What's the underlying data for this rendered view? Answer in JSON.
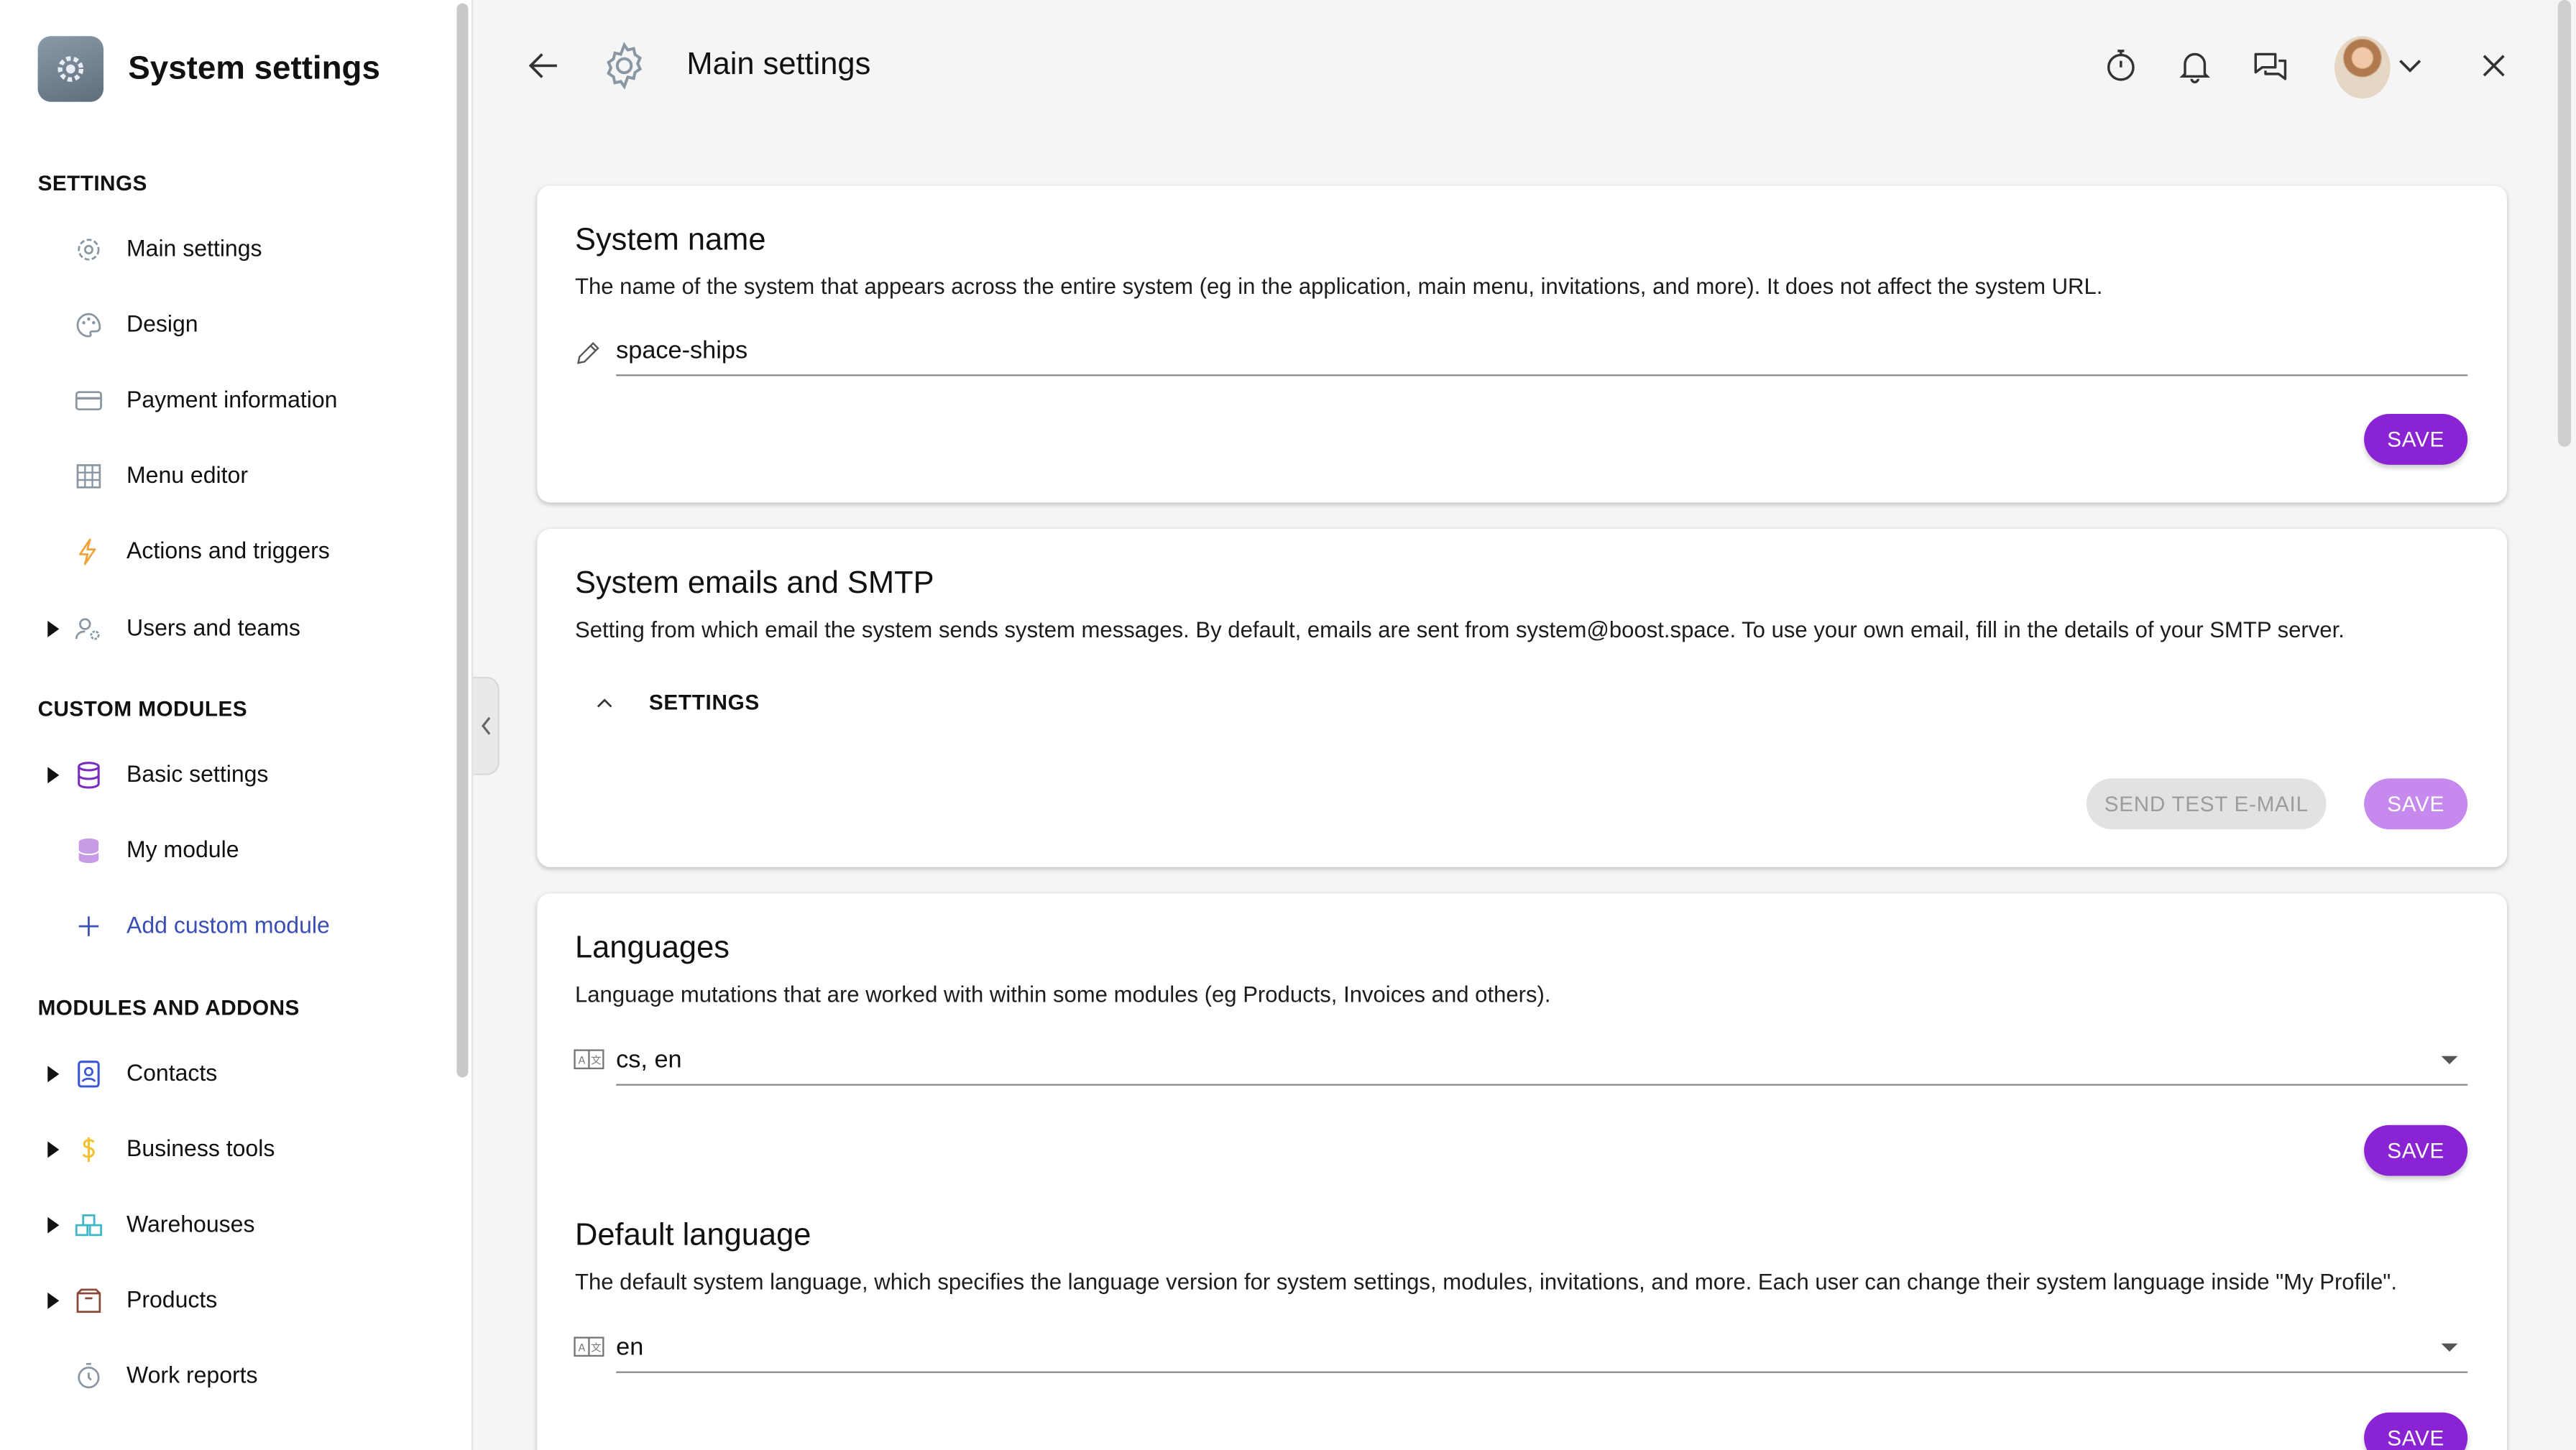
{
  "sidebar": {
    "app_title": "System settings",
    "sections": {
      "settings": "SETTINGS",
      "custom_modules": "CUSTOM MODULES",
      "modules_addons": "MODULES AND ADDONS"
    },
    "settings_items": [
      {
        "label": "Main settings",
        "icon": "gear-icon"
      },
      {
        "label": "Design",
        "icon": "palette-icon"
      },
      {
        "label": "Payment information",
        "icon": "card-icon"
      },
      {
        "label": "Menu editor",
        "icon": "grid-icon"
      },
      {
        "label": "Actions and triggers",
        "icon": "bolt-icon"
      },
      {
        "label": "Users and teams",
        "icon": "users-gear-icon"
      }
    ],
    "custom_items": [
      {
        "label": "Basic settings",
        "icon": "database-icon"
      },
      {
        "label": "My module",
        "icon": "database-icon"
      },
      {
        "label": "Add custom module",
        "icon": "plus-icon"
      }
    ],
    "addon_items": [
      {
        "label": "Contacts",
        "icon": "contact-book-icon"
      },
      {
        "label": "Business tools",
        "icon": "dollar-icon"
      },
      {
        "label": "Warehouses",
        "icon": "warehouse-icon"
      },
      {
        "label": "Products",
        "icon": "box-icon"
      },
      {
        "label": "Work reports",
        "icon": "stopwatch-icon"
      }
    ]
  },
  "header": {
    "title": "Main settings"
  },
  "cards": {
    "system_name": {
      "title": "System name",
      "description": "The name of the system that appears across the entire system (eg in the application, main menu, invitations, and more). It does not affect the system URL.",
      "value": "space-ships",
      "save_label": "SAVE"
    },
    "smtp": {
      "title": "System emails and SMTP",
      "description": "Setting from which email the system sends system messages. By default, emails are sent from system@boost.space. To use your own email, fill in the details of your SMTP server.",
      "accordion_label": "SETTINGS",
      "test_label": "SEND TEST E-MAIL",
      "save_label": "SAVE"
    },
    "languages": {
      "title": "Languages",
      "description": "Language mutations that are worked with within some modules (eg Products, Invoices and others).",
      "value": "cs, en",
      "save_label": "SAVE"
    },
    "default_language": {
      "title": "Default language",
      "description": "The default system language, which specifies the language version for system settings, modules, invitations, and more. Each user can change their system language inside \"My Profile\".",
      "value": "en",
      "save_label": "SAVE"
    }
  },
  "colors": {
    "accent": "#8a23d3",
    "accent_disabled": "#c68aee",
    "link": "#3a4fb5"
  }
}
